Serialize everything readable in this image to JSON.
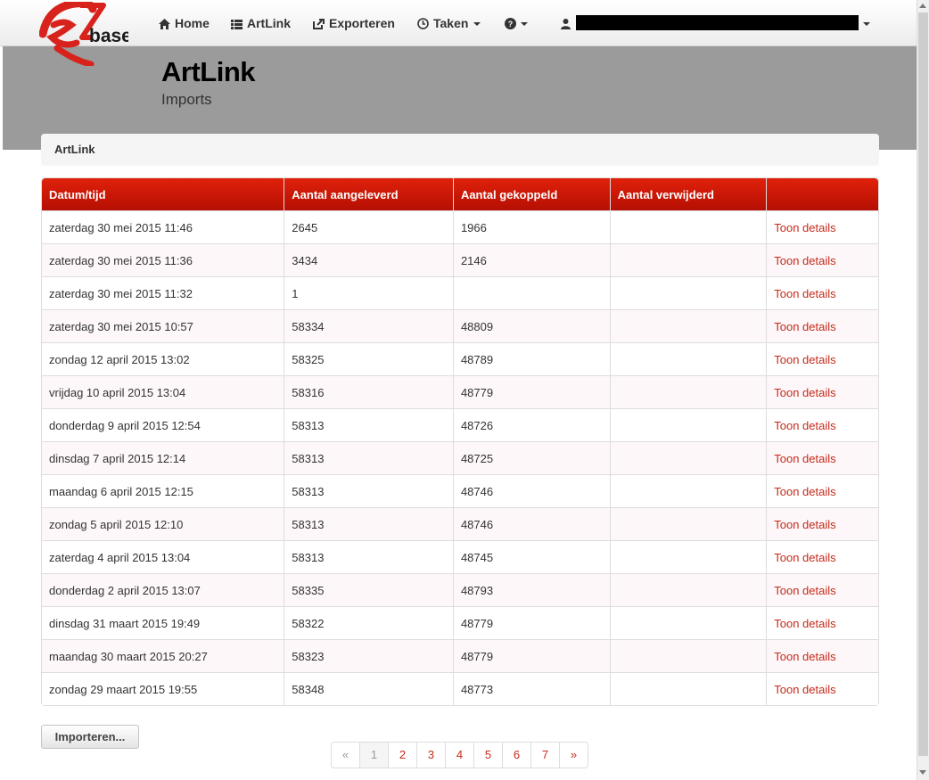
{
  "nav": {
    "logo_text": "eZbase",
    "home": "Home",
    "artlink": "ArtLink",
    "exporteren": "Exporteren",
    "taken": "Taken",
    "help_icon": "question-circle-icon",
    "user_icon": "user-icon"
  },
  "header": {
    "title": "ArtLink",
    "subtitle": "Imports"
  },
  "breadcrumb": {
    "label": "ArtLink"
  },
  "table": {
    "columns": [
      "Datum/tijd",
      "Aantal aangeleverd",
      "Aantal gekoppeld",
      "Aantal verwijderd",
      ""
    ],
    "rows": [
      {
        "datetime": "zaterdag 30 mei 2015 11:46",
        "aangeleverd": "2645",
        "gekoppeld": "1966",
        "verwijderd": "",
        "action": "Toon details"
      },
      {
        "datetime": "zaterdag 30 mei 2015 11:36",
        "aangeleverd": "3434",
        "gekoppeld": "2146",
        "verwijderd": "",
        "action": "Toon details"
      },
      {
        "datetime": "zaterdag 30 mei 2015 11:32",
        "aangeleverd": "1",
        "gekoppeld": "",
        "verwijderd": "",
        "action": "Toon details"
      },
      {
        "datetime": "zaterdag 30 mei 2015 10:57",
        "aangeleverd": "58334",
        "gekoppeld": "48809",
        "verwijderd": "",
        "action": "Toon details"
      },
      {
        "datetime": "zondag 12 april 2015 13:02",
        "aangeleverd": "58325",
        "gekoppeld": "48789",
        "verwijderd": "",
        "action": "Toon details"
      },
      {
        "datetime": "vrijdag 10 april 2015 13:04",
        "aangeleverd": "58316",
        "gekoppeld": "48779",
        "verwijderd": "",
        "action": "Toon details"
      },
      {
        "datetime": "donderdag 9 april 2015 12:54",
        "aangeleverd": "58313",
        "gekoppeld": "48726",
        "verwijderd": "",
        "action": "Toon details"
      },
      {
        "datetime": "dinsdag 7 april 2015 12:14",
        "aangeleverd": "58313",
        "gekoppeld": "48725",
        "verwijderd": "",
        "action": "Toon details"
      },
      {
        "datetime": "maandag 6 april 2015 12:15",
        "aangeleverd": "58313",
        "gekoppeld": "48746",
        "verwijderd": "",
        "action": "Toon details"
      },
      {
        "datetime": "zondag 5 april 2015 12:10",
        "aangeleverd": "58313",
        "gekoppeld": "48746",
        "verwijderd": "",
        "action": "Toon details"
      },
      {
        "datetime": "zaterdag 4 april 2015 13:04",
        "aangeleverd": "58313",
        "gekoppeld": "48745",
        "verwijderd": "",
        "action": "Toon details"
      },
      {
        "datetime": "donderdag 2 april 2015 13:07",
        "aangeleverd": "58335",
        "gekoppeld": "48793",
        "verwijderd": "",
        "action": "Toon details"
      },
      {
        "datetime": "dinsdag 31 maart 2015 19:49",
        "aangeleverd": "58322",
        "gekoppeld": "48779",
        "verwijderd": "",
        "action": "Toon details"
      },
      {
        "datetime": "maandag 30 maart 2015 20:27",
        "aangeleverd": "58323",
        "gekoppeld": "48779",
        "verwijderd": "",
        "action": "Toon details"
      },
      {
        "datetime": "zondag 29 maart 2015 19:55",
        "aangeleverd": "58348",
        "gekoppeld": "48773",
        "verwijderd": "",
        "action": "Toon details"
      }
    ]
  },
  "import_button": "Importeren...",
  "pagination": {
    "prev": "«",
    "pages": [
      "1",
      "2",
      "3",
      "4",
      "5",
      "6",
      "7"
    ],
    "active": "1",
    "next": "»"
  },
  "colors": {
    "accent": "#c62a1a",
    "header_red_top": "#e0210b",
    "header_red_bottom": "#b50f02",
    "band_gray": "#9a9b9a"
  }
}
